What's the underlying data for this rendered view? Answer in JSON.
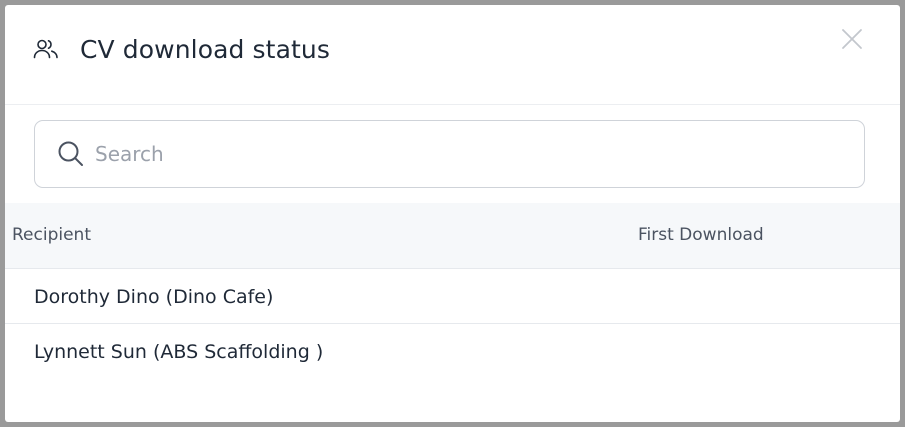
{
  "modal": {
    "title": "CV download status",
    "header_icon": "users-icon",
    "close_icon": "close-icon"
  },
  "search": {
    "placeholder": "Search",
    "value": "",
    "icon": "search-icon"
  },
  "table": {
    "columns": [
      "Recipient",
      "First Download"
    ],
    "rows": [
      {
        "recipient": "Dorothy Dino (Dino Cafe)",
        "first_download": ""
      },
      {
        "recipient": "Lynnett Sun (ABS Scaffolding )",
        "first_download": ""
      }
    ]
  },
  "colors": {
    "backdrop": "#9a9a9a",
    "text": "#1f2937",
    "header_row_bg": "#f6f8fa",
    "border": "#cfd3d9"
  }
}
